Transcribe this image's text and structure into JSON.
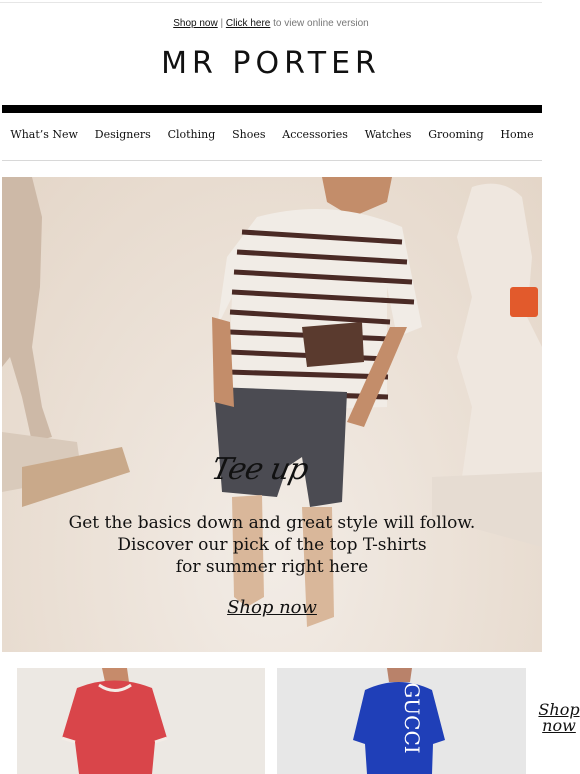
{
  "preheader": {
    "shop_now": "Shop now",
    "separator": "|",
    "click_here": "Click here",
    "suffix": "to view online version"
  },
  "brand": {
    "logo": "MR PORTER"
  },
  "nav": {
    "items": [
      "What’s New",
      "Designers",
      "Clothing",
      "Shoes",
      "Accessories",
      "Watches",
      "Grooming",
      "Home"
    ]
  },
  "hero": {
    "script_title": "Tee up",
    "lines": [
      "Get the basics down and great style will follow.",
      "Discover our pick of the top T-shirts",
      "for summer right here"
    ],
    "cta": "Shop now"
  },
  "products": {
    "card1_logo": "",
    "card2_print": "GUCCI",
    "cta": "Shop now"
  },
  "colors": {
    "black": "#000000",
    "hero_bg": "#ece2d8",
    "tee_red": "#d9454a",
    "tee_blue": "#1f3fb8"
  }
}
